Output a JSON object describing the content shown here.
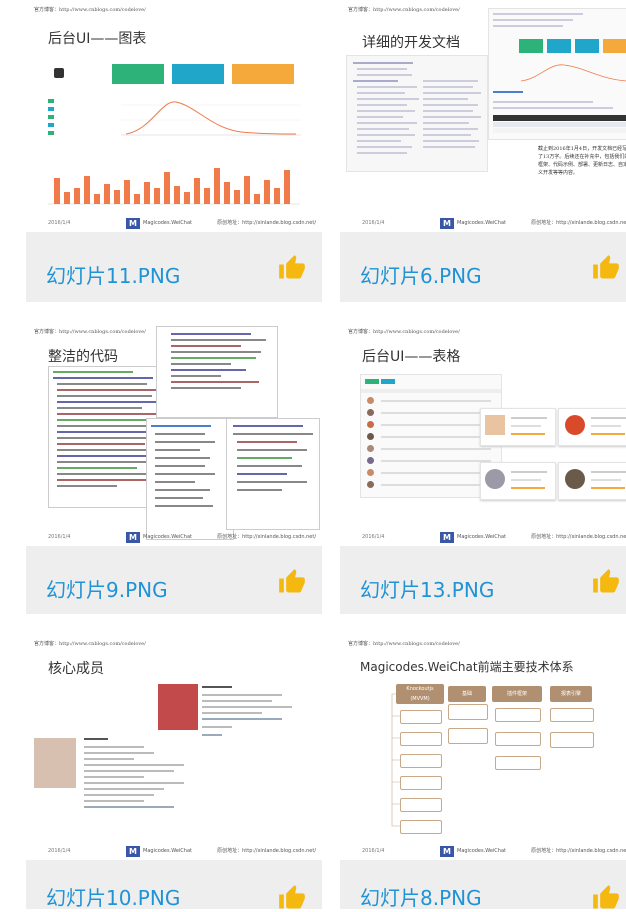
{
  "cards": [
    {
      "caption": "幻灯片11.PNG",
      "slide_title": "后台UI——图表"
    },
    {
      "caption": "幻灯片6.PNG",
      "slide_title": "详细的开发文档"
    },
    {
      "caption": "幻灯片9.PNG",
      "slide_title": "整洁的代码"
    },
    {
      "caption": "幻灯片13.PNG",
      "slide_title": "后台UI——表格"
    },
    {
      "caption": "幻灯片10.PNG",
      "slide_title": "核心成员"
    },
    {
      "caption": "幻灯片8.PNG",
      "slide_title": "Magicodes.WeiChat前端主要技术体系"
    }
  ],
  "slide_common": {
    "url": "官方博客：http://www.cnblogs.com/codelove/",
    "date": "2016/1/4",
    "logo_text": "Magicodes.WeiChat",
    "blog": "原创地址：http://xinlande.blog.csdn.net/"
  },
  "slide6_note": "截止到2016年1月4日，开发文档已经写了13万字。后续还在补充中，包括我们的框架、代码示例、部署、更新日志、自定义开发等等内容。",
  "slide8_headers": [
    "Knockoutjs (MVVM)",
    "基础",
    "插件框架",
    "报表引擎"
  ],
  "colors": {
    "caption": "#1f93d6",
    "thumb": "#f5b80f",
    "card_bg": "#eeeeee"
  }
}
